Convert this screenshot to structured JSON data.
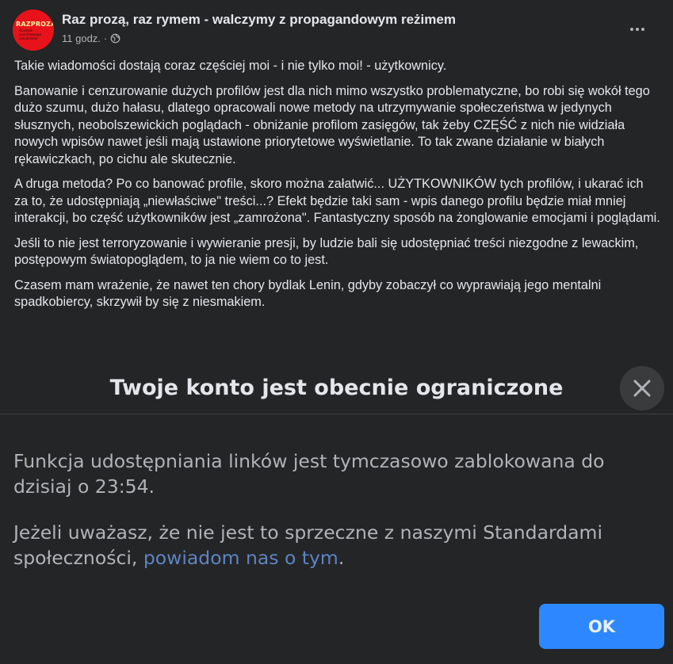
{
  "post": {
    "avatar_logo_text": "RAZPROZA",
    "avatar_logo_subtext": "Oczepek anonimowego nieudolnika",
    "page_name": "Raz prozą, raz rymem - walczymy z propagandowym reżimem",
    "time": "11 godz.",
    "separator": "·",
    "paragraphs": [
      "Takie wiadomości dostają coraz częściej moi - i nie tylko moi! - użytkownicy.",
      "Banowanie i cenzurowanie dużych profilów jest dla nich mimo wszystko problematyczne, bo robi się wokół tego dużo szumu, dużo hałasu, dlatego opracowali nowe metody na utrzymywanie społeczeństwa w jedynych słusznych, neobolszewickich poglądach - obniżanie profilom zasięgów, tak żeby CZĘŚĆ z nich nie widziała nowych wpisów nawet jeśli mają ustawione priorytetowe wyświetlanie. To tak zwane działanie w białych rękawiczkach, po cichu ale skutecznie.",
      "A druga metoda? Po co banować profile, skoro można załatwić... UŻYTKOWNIKÓW tych profilów, i ukarać ich za to, że udostępniają „niewłaściwe\" treści...? Efekt będzie taki sam - wpis danego profilu będzie miał mniej interakcji, bo część użytkowników jest „zamrożona\". Fantastyczny sposób na żonglowanie emocjami i poglądami.",
      "Jeśli to nie jest terroryzowanie i wywieranie presji, by ludzie bali się udostępniać treści niezgodne z lewackim, postępowym światopoglądem, to ja nie wiem co to jest.",
      "Czasem mam wrażenie, że nawet ten chory bydlak Lenin, gdyby zobaczył co wyprawiają jego mentalni spadkobiercy, skrzywił by się z niesmakiem."
    ]
  },
  "dialog": {
    "title": "Twoje konto jest obecnie ograniczone",
    "body_1": "Funkcja udostępniania linków jest tymczasowo zablokowana do dzisiaj o 23:54.",
    "body_2_prefix": "Jeżeli uważasz, że nie jest to sprzeczne z naszymi Standardami społeczności, ",
    "body_2_link": "powiadom nas o tym",
    "body_2_suffix": ".",
    "ok_label": "OK"
  },
  "colors": {
    "background": "#242526",
    "text_primary": "#e4e6eb",
    "text_secondary": "#b0b3b8",
    "link": "#5e84c4",
    "button_blue": "#2d88ff",
    "avatar_red": "#e8121b"
  },
  "icons": [
    "globe-icon",
    "more-options-icon",
    "close-icon"
  ]
}
